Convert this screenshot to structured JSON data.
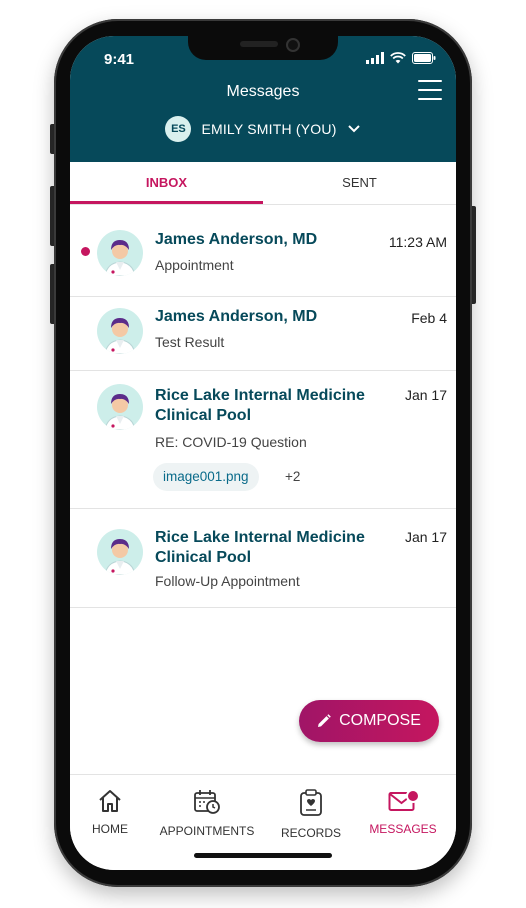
{
  "status_bar": {
    "time": "9:41"
  },
  "header": {
    "title": "Messages",
    "user_initials": "ES",
    "user_name": "EMILY SMITH (YOU)"
  },
  "tabs": [
    {
      "label": "INBOX",
      "active": true
    },
    {
      "label": "SENT",
      "active": false
    }
  ],
  "messages": [
    {
      "sender": "James Anderson, MD",
      "date": "11:23 AM",
      "subject": "Appointment",
      "unread": true
    },
    {
      "sender": "James Anderson, MD",
      "date": "Feb 4",
      "subject": "Test Result",
      "unread": false
    },
    {
      "sender": "Rice Lake Internal Medicine Clinical Pool",
      "date": "Jan 17",
      "subject": "RE: COVID-19 Question",
      "unread": false,
      "attachment": "image001.png",
      "attachment_more": "+2"
    },
    {
      "sender": "Rice Lake Internal Medicine Clinical Pool",
      "date": "Jan 17",
      "subject": "Follow-Up Appointment",
      "unread": false
    }
  ],
  "compose": {
    "label": "COMPOSE",
    "icon": "pencil-icon"
  },
  "bottom_nav": [
    {
      "label": "HOME",
      "icon": "home-icon",
      "active": false
    },
    {
      "label": "APPOINTMENTS",
      "icon": "calendar-clock-icon",
      "active": false
    },
    {
      "label": "RECORDS",
      "icon": "clipboard-heart-icon",
      "active": false
    },
    {
      "label": "MESSAGES",
      "icon": "envelope-icon",
      "active": true,
      "badge": true
    }
  ],
  "colors": {
    "header_bg": "#06495a",
    "accent": "#c5165f",
    "sender_text": "#06495a"
  }
}
